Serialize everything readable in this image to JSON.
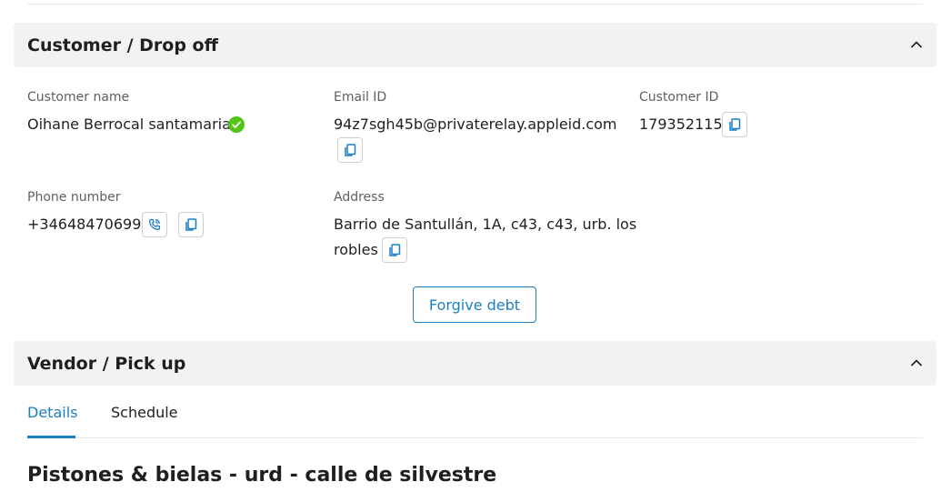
{
  "customer_section": {
    "title": "Customer / Drop off",
    "customer_name_label": "Customer name",
    "customer_name": "Oihane Berrocal santamaria",
    "email_label": "Email ID",
    "email": "94z7sgh45b@privaterelay.appleid.com",
    "customer_id_label": "Customer ID",
    "customer_id": "179352115",
    "phone_label": "Phone number",
    "phone": "+34648470699",
    "address_label": "Address",
    "address_line1": "Barrio de Santullán, 1A, c43, c43, urb. los",
    "address_line2": "robles",
    "forgive_button": "Forgive debt"
  },
  "vendor_section": {
    "title": "Vendor / Pick up",
    "tabs": [
      {
        "label": "Details",
        "active": true
      },
      {
        "label": "Schedule",
        "active": false
      }
    ],
    "vendor_name": "Pistones & bielas - urd - calle de silvestre"
  },
  "colors": {
    "accent": "#1a7fc1",
    "verified": "#52c41a",
    "header_bg": "#f2f2f2"
  },
  "icons": {
    "collapse": "chevron-up-icon",
    "copy": "copy-icon",
    "call": "phone-call-icon",
    "verified": "check-circle-icon"
  }
}
